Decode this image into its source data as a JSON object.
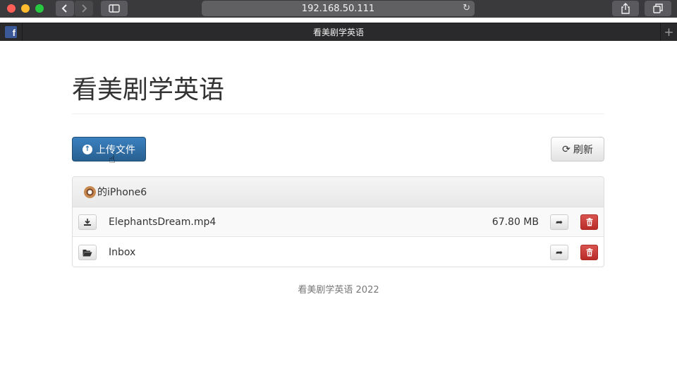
{
  "browser": {
    "address": "192.168.50.111",
    "tab_title": "看美剧学英语",
    "pinned_tab_letter": "f"
  },
  "page": {
    "title": "看美剧学英语",
    "upload_label": "上传文件",
    "refresh_label": "刷新",
    "device_name": "的iPhone6",
    "files": [
      {
        "name": "ElephantsDream.mp4",
        "size": "67.80 MB",
        "icon": "download-icon"
      },
      {
        "name": "Inbox",
        "size": "",
        "icon": "folder-open-icon"
      }
    ],
    "footer": "看美剧学英语 2022"
  },
  "colors": {
    "primary": "#337ab7",
    "danger": "#d9534f",
    "titlebar": "#3a3a3c"
  }
}
